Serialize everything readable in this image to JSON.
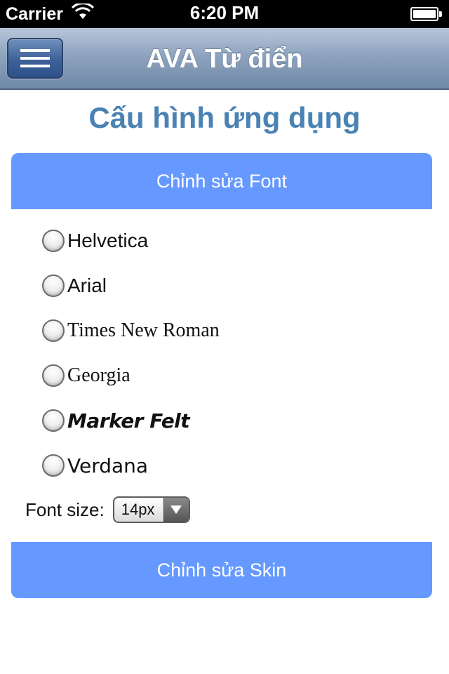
{
  "status_bar": {
    "carrier": "Carrier",
    "time": "6:20 PM"
  },
  "nav": {
    "title": "AVA Từ điển"
  },
  "page": {
    "title": "Cấu hình ứng dụng"
  },
  "font_section": {
    "header": "Chỉnh sửa Font",
    "options": [
      "Helvetica",
      "Arial",
      "Times New Roman",
      "Georgia",
      "Marker Felt",
      "Verdana"
    ],
    "size_label": "Font size:",
    "size_value": "14px"
  },
  "skin_section": {
    "header": "Chỉnh sửa Skin"
  },
  "colors": {
    "accent_header": "#6699ff",
    "title_blue": "#4a82b4"
  }
}
